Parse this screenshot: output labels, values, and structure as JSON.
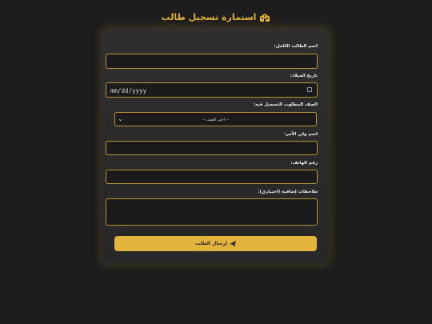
{
  "header": {
    "title": "استمارة تسجيل طالب",
    "icon": "school-icon"
  },
  "form": {
    "student_name_label": "اسم الطالب الكامل:",
    "student_name_value": "",
    "birth_date_label": "تاريخ الميلاد:",
    "birth_date_placeholder": "mm/dd/yyyy",
    "grade_label": "الصف المطلوب التسجيل فيه:",
    "grade_selected": "-- اختر الصف --",
    "guardian_label": "اسم ولي الأمر:",
    "guardian_value": "",
    "phone_label": "رقم الهاتف:",
    "phone_value": "",
    "notes_label": "ملاحظات إضافية (اختياري):",
    "notes_value": "",
    "submit_label": "إرسال الطلب",
    "submit_icon": "paper-plane-icon"
  },
  "colors": {
    "accent": "#e2b43c",
    "background": "#1d1d1d",
    "card": "#2b2b2b",
    "field_border": "#b89534"
  }
}
